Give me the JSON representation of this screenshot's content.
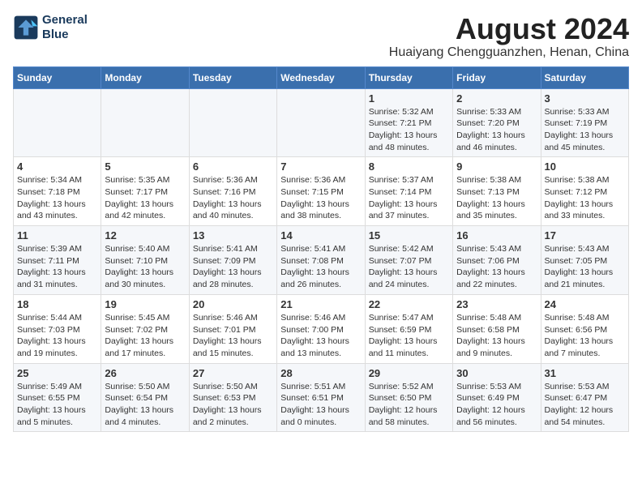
{
  "header": {
    "logo_line1": "General",
    "logo_line2": "Blue",
    "main_title": "August 2024",
    "subtitle": "Huaiyang Chengguanzhen, Henan, China"
  },
  "columns": [
    "Sunday",
    "Monday",
    "Tuesday",
    "Wednesday",
    "Thursday",
    "Friday",
    "Saturday"
  ],
  "weeks": [
    [
      {
        "day": "",
        "info": ""
      },
      {
        "day": "",
        "info": ""
      },
      {
        "day": "",
        "info": ""
      },
      {
        "day": "",
        "info": ""
      },
      {
        "day": "1",
        "info": "Sunrise: 5:32 AM\nSunset: 7:21 PM\nDaylight: 13 hours\nand 48 minutes."
      },
      {
        "day": "2",
        "info": "Sunrise: 5:33 AM\nSunset: 7:20 PM\nDaylight: 13 hours\nand 46 minutes."
      },
      {
        "day": "3",
        "info": "Sunrise: 5:33 AM\nSunset: 7:19 PM\nDaylight: 13 hours\nand 45 minutes."
      }
    ],
    [
      {
        "day": "4",
        "info": "Sunrise: 5:34 AM\nSunset: 7:18 PM\nDaylight: 13 hours\nand 43 minutes."
      },
      {
        "day": "5",
        "info": "Sunrise: 5:35 AM\nSunset: 7:17 PM\nDaylight: 13 hours\nand 42 minutes."
      },
      {
        "day": "6",
        "info": "Sunrise: 5:36 AM\nSunset: 7:16 PM\nDaylight: 13 hours\nand 40 minutes."
      },
      {
        "day": "7",
        "info": "Sunrise: 5:36 AM\nSunset: 7:15 PM\nDaylight: 13 hours\nand 38 minutes."
      },
      {
        "day": "8",
        "info": "Sunrise: 5:37 AM\nSunset: 7:14 PM\nDaylight: 13 hours\nand 37 minutes."
      },
      {
        "day": "9",
        "info": "Sunrise: 5:38 AM\nSunset: 7:13 PM\nDaylight: 13 hours\nand 35 minutes."
      },
      {
        "day": "10",
        "info": "Sunrise: 5:38 AM\nSunset: 7:12 PM\nDaylight: 13 hours\nand 33 minutes."
      }
    ],
    [
      {
        "day": "11",
        "info": "Sunrise: 5:39 AM\nSunset: 7:11 PM\nDaylight: 13 hours\nand 31 minutes."
      },
      {
        "day": "12",
        "info": "Sunrise: 5:40 AM\nSunset: 7:10 PM\nDaylight: 13 hours\nand 30 minutes."
      },
      {
        "day": "13",
        "info": "Sunrise: 5:41 AM\nSunset: 7:09 PM\nDaylight: 13 hours\nand 28 minutes."
      },
      {
        "day": "14",
        "info": "Sunrise: 5:41 AM\nSunset: 7:08 PM\nDaylight: 13 hours\nand 26 minutes."
      },
      {
        "day": "15",
        "info": "Sunrise: 5:42 AM\nSunset: 7:07 PM\nDaylight: 13 hours\nand 24 minutes."
      },
      {
        "day": "16",
        "info": "Sunrise: 5:43 AM\nSunset: 7:06 PM\nDaylight: 13 hours\nand 22 minutes."
      },
      {
        "day": "17",
        "info": "Sunrise: 5:43 AM\nSunset: 7:05 PM\nDaylight: 13 hours\nand 21 minutes."
      }
    ],
    [
      {
        "day": "18",
        "info": "Sunrise: 5:44 AM\nSunset: 7:03 PM\nDaylight: 13 hours\nand 19 minutes."
      },
      {
        "day": "19",
        "info": "Sunrise: 5:45 AM\nSunset: 7:02 PM\nDaylight: 13 hours\nand 17 minutes."
      },
      {
        "day": "20",
        "info": "Sunrise: 5:46 AM\nSunset: 7:01 PM\nDaylight: 13 hours\nand 15 minutes."
      },
      {
        "day": "21",
        "info": "Sunrise: 5:46 AM\nSunset: 7:00 PM\nDaylight: 13 hours\nand 13 minutes."
      },
      {
        "day": "22",
        "info": "Sunrise: 5:47 AM\nSunset: 6:59 PM\nDaylight: 13 hours\nand 11 minutes."
      },
      {
        "day": "23",
        "info": "Sunrise: 5:48 AM\nSunset: 6:58 PM\nDaylight: 13 hours\nand 9 minutes."
      },
      {
        "day": "24",
        "info": "Sunrise: 5:48 AM\nSunset: 6:56 PM\nDaylight: 13 hours\nand 7 minutes."
      }
    ],
    [
      {
        "day": "25",
        "info": "Sunrise: 5:49 AM\nSunset: 6:55 PM\nDaylight: 13 hours\nand 5 minutes."
      },
      {
        "day": "26",
        "info": "Sunrise: 5:50 AM\nSunset: 6:54 PM\nDaylight: 13 hours\nand 4 minutes."
      },
      {
        "day": "27",
        "info": "Sunrise: 5:50 AM\nSunset: 6:53 PM\nDaylight: 13 hours\nand 2 minutes."
      },
      {
        "day": "28",
        "info": "Sunrise: 5:51 AM\nSunset: 6:51 PM\nDaylight: 13 hours\nand 0 minutes."
      },
      {
        "day": "29",
        "info": "Sunrise: 5:52 AM\nSunset: 6:50 PM\nDaylight: 12 hours\nand 58 minutes."
      },
      {
        "day": "30",
        "info": "Sunrise: 5:53 AM\nSunset: 6:49 PM\nDaylight: 12 hours\nand 56 minutes."
      },
      {
        "day": "31",
        "info": "Sunrise: 5:53 AM\nSunset: 6:47 PM\nDaylight: 12 hours\nand 54 minutes."
      }
    ]
  ]
}
